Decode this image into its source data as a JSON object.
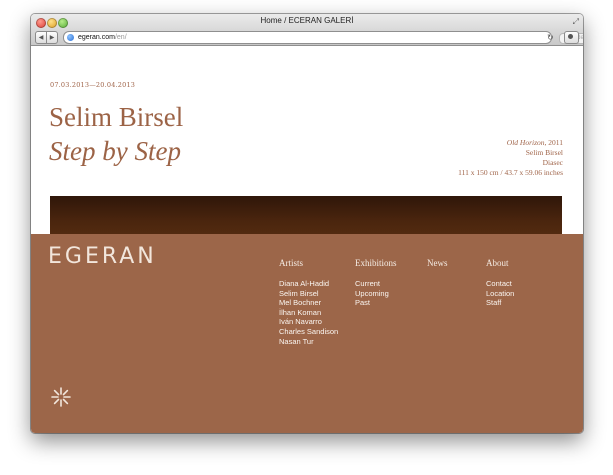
{
  "browser": {
    "title": "Home / ECERAN GALERİ",
    "url_domain": "egeran.com",
    "url_path": "/en/",
    "reader_label": "Reader"
  },
  "exhibition": {
    "dates": "07.03.2013—20.04.2013",
    "artist": "Selim Birsel",
    "title": "Step by Step"
  },
  "caption": {
    "work_title": "Old Horizon",
    "year": ", 2011",
    "artist": "Selim Birsel",
    "medium": "Diasec",
    "dimensions": "111 x 150 cm / 43.7 x 59.06 inches"
  },
  "footer": {
    "logo": "EGERAN",
    "columns": {
      "artists": {
        "heading": "Artists",
        "items": [
          "Diana Al-Hadid",
          "Selim Birsel",
          "Mel Bochner",
          "İlhan Koman",
          "Iván Navarro",
          "Charles Sandison",
          "Nasan Tur"
        ]
      },
      "exhibitions": {
        "heading": "Exhibitions",
        "items": [
          "Current",
          "Upcoming",
          "Past"
        ]
      },
      "news": {
        "heading": "News"
      },
      "about": {
        "heading": "About",
        "items": [
          "Contact",
          "Location",
          "Staff"
        ]
      }
    }
  },
  "colors": {
    "accent": "#9c6346",
    "footer_bg": "#9c6649"
  }
}
